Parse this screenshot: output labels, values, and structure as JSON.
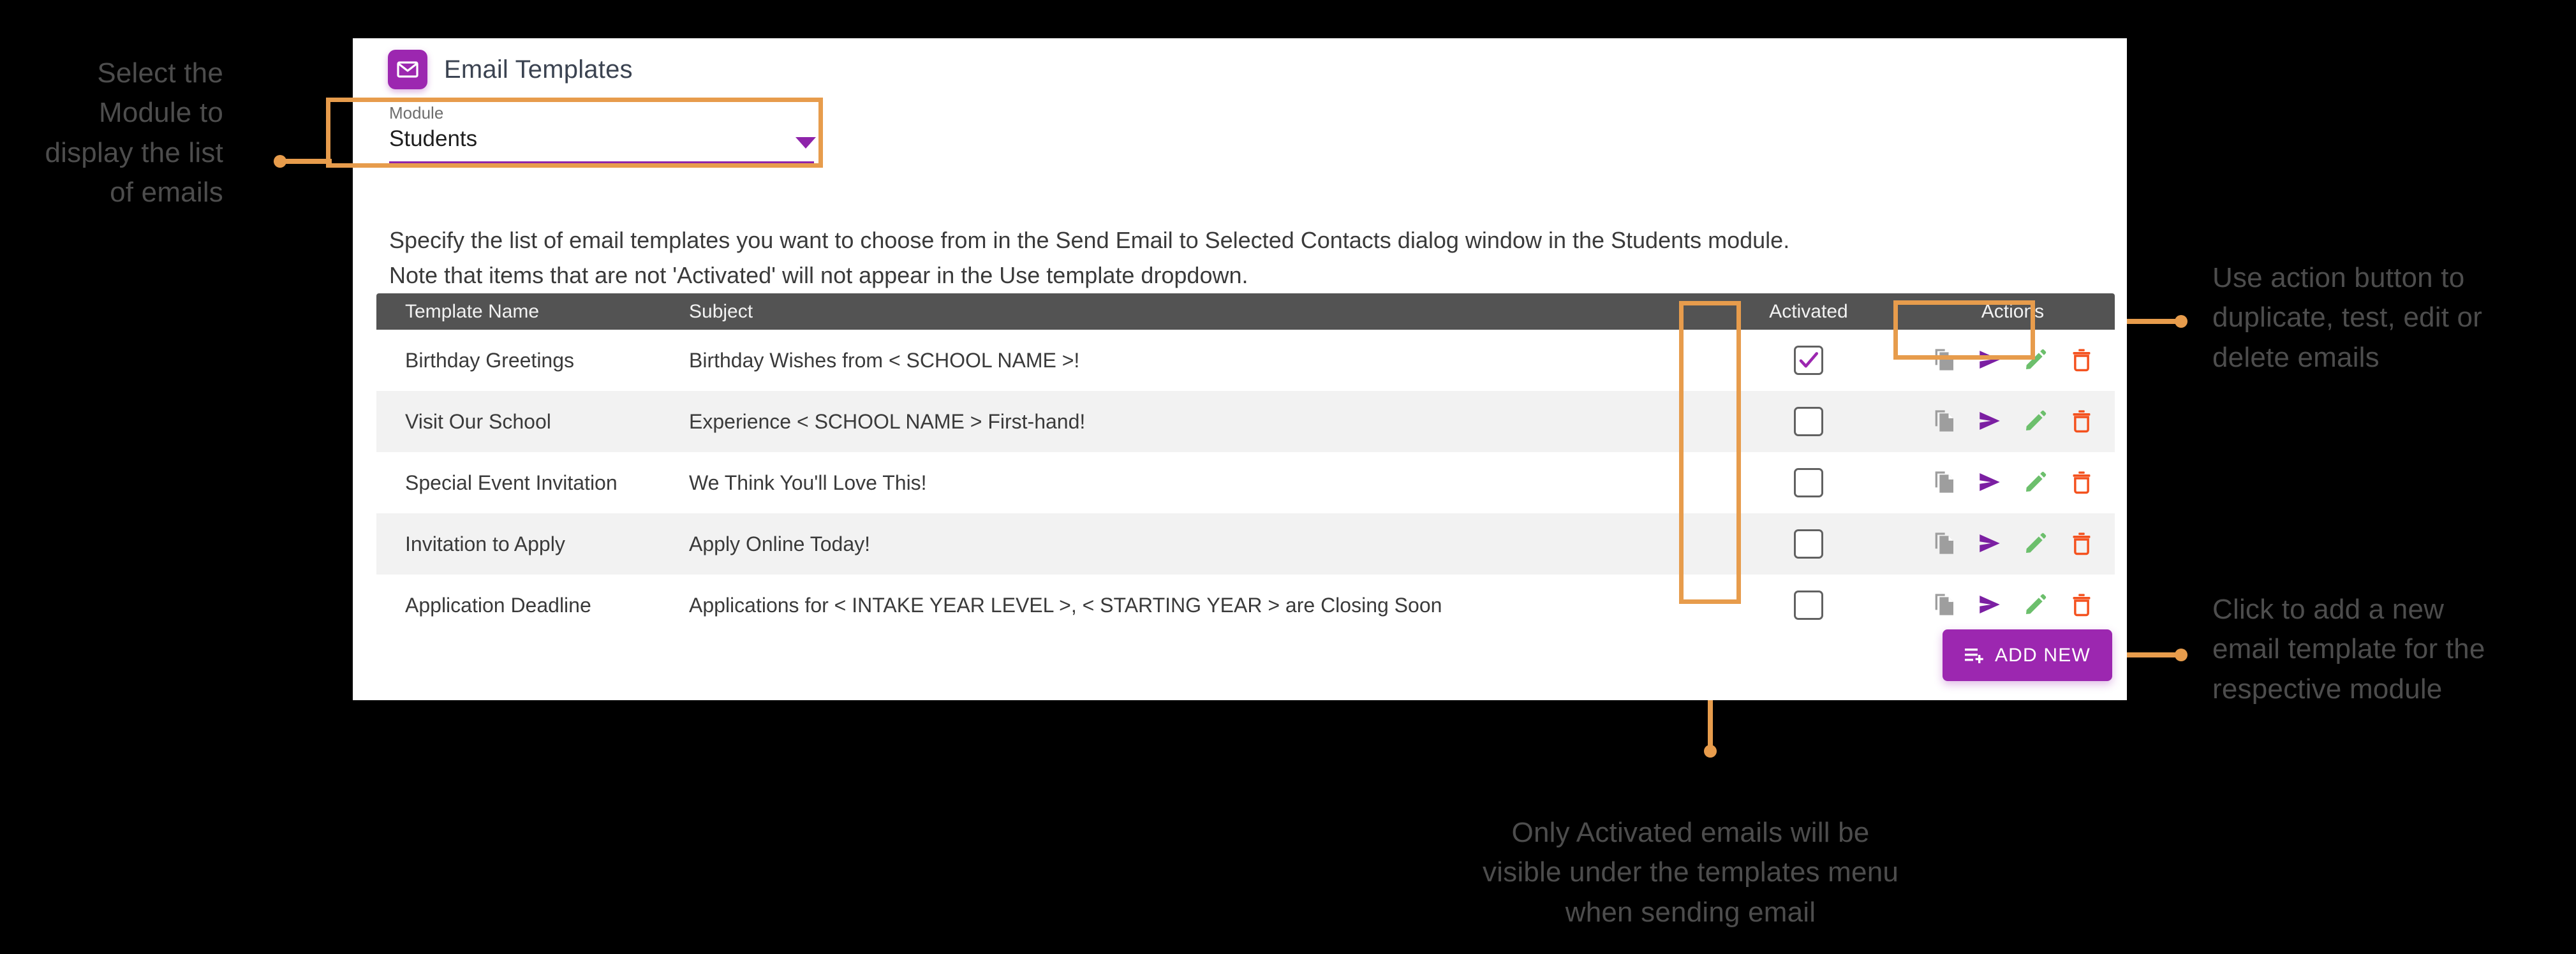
{
  "card": {
    "app_title": "Email Templates",
    "app_icon": "envelope-icon",
    "module": {
      "label": "Module",
      "value": "Students",
      "caret_icon": "chevron-down-icon"
    },
    "description_line1": "Specify the list of email templates you want to choose from in the Send Email to Selected Contacts dialog window in the Students module.",
    "description_line2": "Note that items that are not 'Activated' will not appear in the Use template dropdown.",
    "table": {
      "columns": [
        "Template Name",
        "Subject",
        "Activated",
        "Actions"
      ],
      "rows": [
        {
          "name": "Birthday Greetings",
          "subject": "Birthday Wishes from < SCHOOL NAME >!",
          "activated": true
        },
        {
          "name": "Visit Our School",
          "subject": "Experience < SCHOOL NAME > First-hand!",
          "activated": false
        },
        {
          "name": "Special Event Invitation",
          "subject": "We Think You'll Love This!",
          "activated": false
        },
        {
          "name": "Invitation to Apply",
          "subject": "Apply Online Today!",
          "activated": false
        },
        {
          "name": "Application Deadline",
          "subject": "Applications for < INTAKE YEAR LEVEL >, < STARTING YEAR > are Closing Soon",
          "activated": false
        }
      ],
      "action_icons": [
        "duplicate-icon",
        "send-icon",
        "edit-icon",
        "delete-icon"
      ]
    },
    "add_new_button": {
      "label": "ADD NEW",
      "icon": "playlist-add-icon"
    }
  },
  "annotations": {
    "module": "Select the\nModule to\ndisplay the list\nof emails",
    "actions": "Use action button to\nduplicate, test, edit or\ndelete emails",
    "add_new": "Click to add a new\nemail template for the\nrespective module",
    "activated": "Only Activated emails will be\nvisible under the templates menu\nwhen sending email"
  },
  "colors": {
    "accent_purple": "#9c27b0",
    "annotation_orange": "#e79c4c",
    "header_gray": "#535353",
    "send_purple": "#7b1fa2",
    "edit_green": "#6cbf6c",
    "delete_red": "#f4511e",
    "duplicate_gray": "#9e9e9e",
    "text_gray": "#4d4d4d"
  }
}
